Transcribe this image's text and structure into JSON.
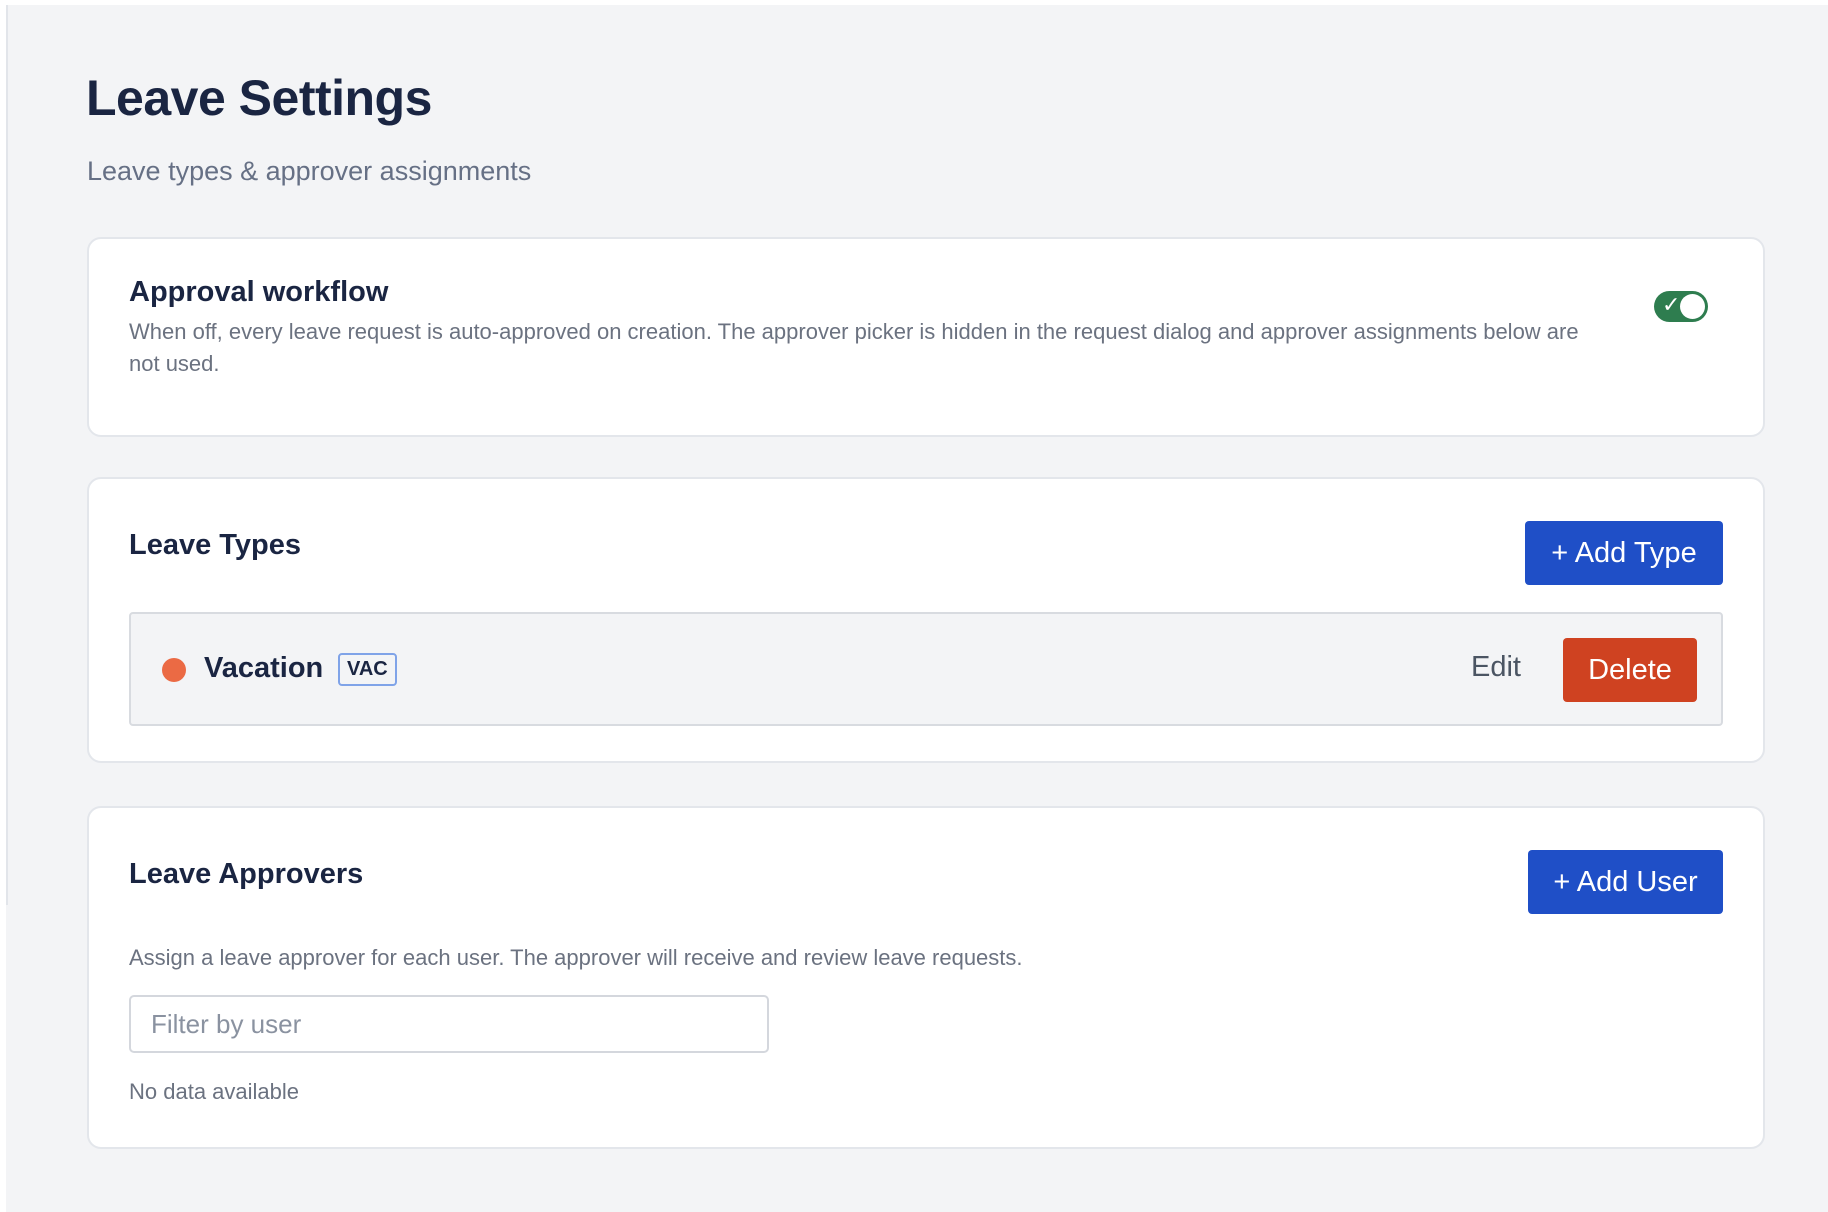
{
  "header": {
    "title": "Leave Settings",
    "subtitle": "Leave types & approver assignments"
  },
  "approval_workflow": {
    "title": "Approval workflow",
    "description": "When off, every leave request is auto-approved on creation. The approver picker is hidden in the request dialog and approver assignments below are not used.",
    "enabled": true,
    "toggle_color": "#2e7d4f"
  },
  "leave_types": {
    "title": "Leave Types",
    "add_button_label": "+ Add Type",
    "items": [
      {
        "name": "Vacation",
        "code": "VAC",
        "color": "#eb6a44",
        "edit_label": "Edit",
        "delete_label": "Delete"
      }
    ]
  },
  "leave_approvers": {
    "title": "Leave Approvers",
    "add_button_label": "+ Add User",
    "description": "Assign a leave approver for each user. The approver will receive and review leave requests.",
    "filter_placeholder": "Filter by user",
    "filter_value": "",
    "empty_text": "No data available"
  },
  "colors": {
    "primary": "#1f4fc7",
    "danger": "#cf4221",
    "background": "#f3f4f6"
  }
}
